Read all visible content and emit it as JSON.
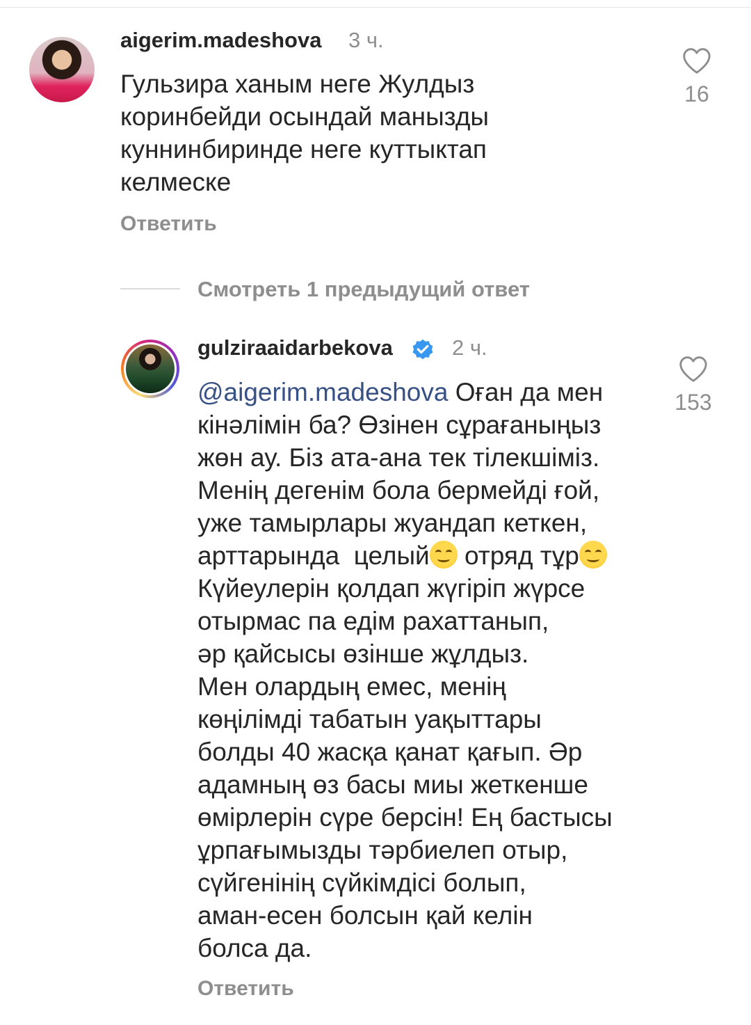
{
  "comment1": {
    "username": "aigerim.madeshova",
    "time": "3 ч.",
    "lines": [
      "Гульзира ханым неге Жулдыз",
      "коринбейди осындай манызды",
      "куннинбиринде неге куттыктап",
      "келмеске"
    ],
    "reply_label": "Ответить",
    "likes": "16",
    "avatar_icon": "user-avatar",
    "like_icon": "heart-icon"
  },
  "view_replies_label": "Смотреть 1 предыдущий ответ",
  "comment2": {
    "username": "gulziraaidarbekova",
    "verified": true,
    "time": "2 ч.",
    "mention": "@aigerim.madeshova",
    "first_line_rest": " Оған да мен",
    "line6_part1": "арттарында  целый",
    "line6_part2": " отряд тұр",
    "lines": [
      "кінәлімін ба? Өзінен сұрағаныңыз",
      "жөн ау. Біз ата-ана тек тілекшіміз.",
      "Менің дегенім бола бермейді ғой,",
      "уже тамырлары жуандап кеткен,"
    ],
    "lines_after": [
      "Күйеулерін қолдап жүгіріп жүрсе",
      "отырмас па едім рахаттанып,",
      "әр қайсысы өзінше жұлдыз.",
      "Мен олардың емес, менің",
      "көңілімді табатын уақыттары",
      "болды 40 жасқа қанат қағып. Әр",
      "адамның өз басы миы жеткенше",
      "өмірлерін сүре берсін! Ең бастысы",
      "ұрпағымызды тәрбиелеп отыр,",
      "сүйгенінің сүйкімдісі болып,",
      "аман-есен болсын қай келін",
      "болса да."
    ],
    "reply_label": "Ответить",
    "likes": "153",
    "emoji": "smiling-face-emoji"
  },
  "colors": {
    "text": "#262626",
    "secondary": "#8e8e8e",
    "mention": "#385185",
    "verified": "#3897f0"
  }
}
